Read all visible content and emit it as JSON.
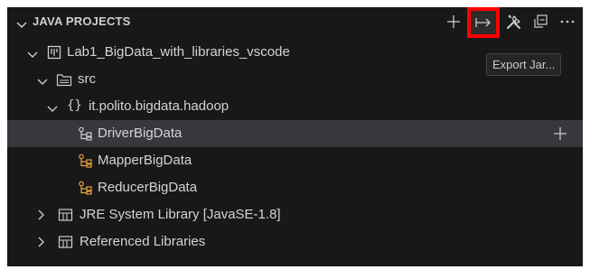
{
  "header": {
    "title": "JAVA PROJECTS",
    "tooltip": "Export Jar..."
  },
  "icons": {
    "header_chevron": "chevron-down-icon",
    "new": "plus-icon",
    "export_jar": "arrow-right-to-bar-icon",
    "build": "tools-icon",
    "collapse": "collapse-all-icon",
    "more": "ellipsis-icon"
  },
  "tree": {
    "project": {
      "label": "Lab1_BigData_with_libraries_vscode",
      "expanded": true
    },
    "src": {
      "label": "src",
      "expanded": true
    },
    "package": {
      "label": "it.polito.bigdata.hadoop",
      "expanded": true
    },
    "classes": [
      {
        "label": "DriverBigData",
        "selected": true
      },
      {
        "label": "MapperBigData",
        "selected": false
      },
      {
        "label": "ReducerBigData",
        "selected": false
      }
    ],
    "jre": {
      "label": "JRE System Library [JavaSE-1.8]",
      "expanded": false
    },
    "referenced": {
      "label": "Referenced Libraries",
      "expanded": false
    }
  },
  "colors": {
    "background": "#181818",
    "selected_row": "#37373d",
    "class_icon_color": "#e8a33d",
    "highlight_border": "#ff0000"
  }
}
